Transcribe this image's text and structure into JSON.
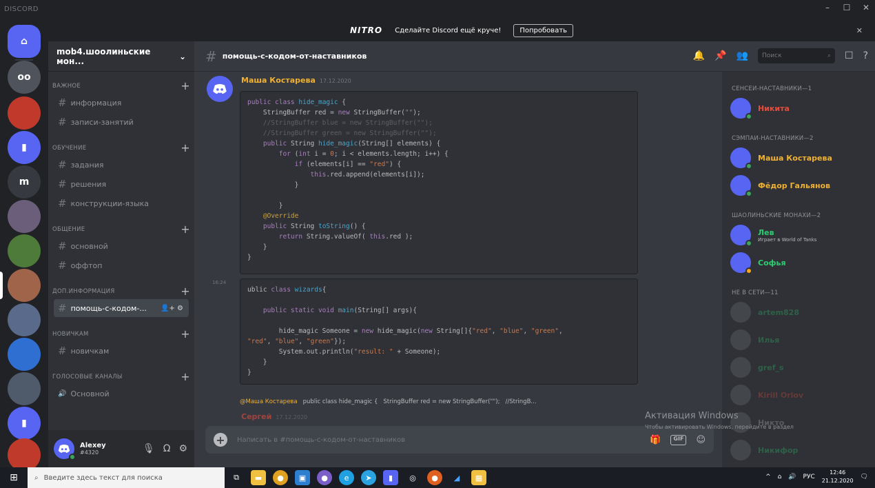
{
  "window": {
    "app_name": "DISCORD",
    "minimize": "–",
    "maximize": "☐",
    "close": "✕"
  },
  "nitro_banner": {
    "logo": "NITRO",
    "message": "Сделайте Discord ещё круче!",
    "button": "Попробовать",
    "close": "✕"
  },
  "rail": {
    "servers": [
      {
        "label": "⌂",
        "color": "#5865f2"
      },
      {
        "label": "oo",
        "color": "#4f545c"
      },
      {
        "label": "",
        "color": "#c0392b"
      },
      {
        "label": "▮",
        "color": "#5865f2"
      },
      {
        "label": "m",
        "color": "#36393f"
      },
      {
        "label": "",
        "color": "#6b5e7a"
      },
      {
        "label": "",
        "color": "#4e7a3a"
      },
      {
        "label": "",
        "color": "#a0644a"
      },
      {
        "label": "",
        "color": "#5a6a8a"
      },
      {
        "label": "",
        "color": "#2f6fd1"
      },
      {
        "label": "",
        "color": "#4f5b6b"
      },
      {
        "label": "▮",
        "color": "#5865f2"
      },
      {
        "label": "",
        "color": "#c03a2b"
      }
    ]
  },
  "guild": {
    "name": "mob4.шоолиньские мон...",
    "categories": [
      {
        "name": "ВАЖНОЕ",
        "channels": [
          "информация",
          "записи-занятий"
        ]
      },
      {
        "name": "ОБУЧЕНИЕ",
        "channels": [
          "задания",
          "решения",
          "конструкции-языка"
        ]
      },
      {
        "name": "ОБЩЕНИЕ",
        "channels": [
          "основной",
          "оффтоп"
        ]
      },
      {
        "name": "ДОП.ИНФОРМАЦИЯ",
        "channels": [
          "помощь-с-кодом-..."
        ]
      },
      {
        "name": "НОВИЧКАМ",
        "channels": [
          "новичкам"
        ]
      },
      {
        "name": "ГОЛОСОВЫЕ КАНАЛЫ",
        "channels": [
          "Основной"
        ]
      }
    ]
  },
  "user_panel": {
    "name": "Alexey",
    "discriminator": "#4320"
  },
  "channel": {
    "title": "помощь-с-кодом-от-наставников",
    "search_placeholder": "Поиск"
  },
  "messages": [
    {
      "author": "Маша Костарева",
      "time": "17.12.2020"
    },
    {
      "stamp": "16:24"
    }
  ],
  "reply": {
    "mention": "@Маша Костарева",
    "snippet1": "public class hide_magic {",
    "snippet2": "StringBuffer red = new StringBuffer(\"\");",
    "snippet3": "//StringB..."
  },
  "next_message": {
    "author": "Сергей",
    "time": "17.12.2020"
  },
  "composer": {
    "placeholder": "Написать в #помощь-с-кодом-от-наставников",
    "gif": "GIF"
  },
  "members": {
    "groups": [
      {
        "name": "СЕНСЕИ-НАСТАВНИКИ—1",
        "members": [
          {
            "name": "Никита",
            "color": "#e74c3c",
            "status": "#3ba55d"
          }
        ]
      },
      {
        "name": "СЭМПАИ-НАСТАВНИКИ—2",
        "members": [
          {
            "name": "Маша Костарева",
            "color": "#f0b132",
            "status": "#3ba55d"
          },
          {
            "name": "Фёдор Гальянов",
            "color": "#f0b132",
            "status": "#3ba55d"
          }
        ]
      },
      {
        "name": "ШАОЛИНЬСКИЕ МОНАХИ—2",
        "members": [
          {
            "name": "Лев",
            "sub": "Играет в World of Tanks",
            "color": "#2ecc71",
            "status": "#3ba55d"
          },
          {
            "name": "Софья",
            "color": "#2ecc71",
            "status": "#faa61a"
          }
        ]
      },
      {
        "name": "НЕ В СЕТИ—11",
        "members": [
          {
            "name": "artem828",
            "color": "#2ecc71"
          },
          {
            "name": "Илья",
            "color": "#2ecc71"
          },
          {
            "name": "gref_s",
            "color": "#2ecc71"
          },
          {
            "name": "Kirill Orlov",
            "color": "#e74c3c"
          },
          {
            "name": "Никто",
            "color": "#b9bbbe"
          },
          {
            "name": "Никифор",
            "color": "#2ecc71"
          }
        ]
      }
    ]
  },
  "activation": {
    "title": "Активация Windows",
    "subtitle": "Чтобы активировать Windows, перейдите в раздел"
  },
  "taskbar": {
    "search_placeholder": "Введите здесь текст для поиска",
    "lang": "РУС",
    "time": "12:46",
    "date": "21.12.2020"
  }
}
